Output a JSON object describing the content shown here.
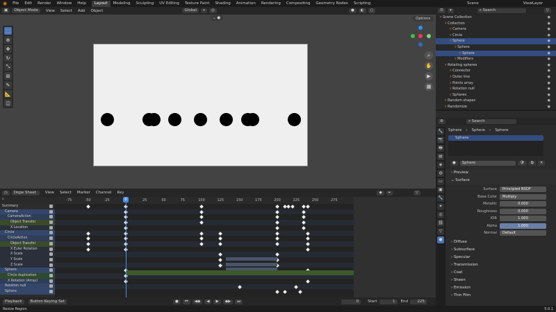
{
  "topbar": {
    "menus": [
      "File",
      "Edit",
      "Render",
      "Window",
      "Help"
    ],
    "workspaces": [
      "Layout",
      "Modeling",
      "Sculpting",
      "UV Editing",
      "Texture Paint",
      "Shading",
      "Animation",
      "Rendering",
      "Compositing",
      "Geometry Nodes",
      "Scripting"
    ],
    "active_workspace": "Layout",
    "scene": "Scene",
    "view_layer": "ViewLayer"
  },
  "viewport_header": {
    "mode": "Object Mode",
    "menus": [
      "View",
      "Select",
      "Add",
      "Object"
    ],
    "orientation": "Global",
    "options": "Options"
  },
  "dopesheet_header": {
    "mode": "Dope Sheet",
    "menus": [
      "View",
      "Select",
      "Marker",
      "Channel",
      "Key"
    ]
  },
  "ruler_ticks": [
    "-75",
    "-50",
    "-25",
    "0",
    "25",
    "50",
    "75",
    "100",
    "125",
    "150",
    "175",
    "200",
    "225",
    "250",
    "275"
  ],
  "current_frame_label": "0",
  "channels": [
    {
      "label": "Summary",
      "indent": 0,
      "bg": "#2d2d2d"
    },
    {
      "label": "Camera",
      "indent": 1,
      "bg": "#34466a"
    },
    {
      "label": "CameraAction",
      "indent": 2,
      "bg": "#2e3d58"
    },
    {
      "label": "Object Transfor",
      "indent": 3,
      "bg": "#3b4a2a"
    },
    {
      "label": "X Location",
      "indent": 3,
      "bg": "#2a2f3a"
    },
    {
      "label": "Circle",
      "indent": 1,
      "bg": "#34466a"
    },
    {
      "label": "CircleAction",
      "indent": 2,
      "bg": "#2e3d58"
    },
    {
      "label": "Object Transfor",
      "indent": 3,
      "bg": "#3b4a2a"
    },
    {
      "label": "X Euler Rotation",
      "indent": 3,
      "bg": "#2a2f3a"
    },
    {
      "label": "X Scale",
      "indent": 3,
      "bg": "#2a2f3a"
    },
    {
      "label": "Y Scale",
      "indent": 3,
      "bg": "#2a2f3a"
    },
    {
      "label": "Z Scale",
      "indent": 3,
      "bg": "#2a2f3a"
    },
    {
      "label": "Sphere",
      "indent": 1,
      "bg": "#34466a"
    },
    {
      "label": "Circle duplication",
      "indent": 2,
      "bg": "#2f4a2a"
    },
    {
      "label": "X Rotation (Array)",
      "indent": 2,
      "bg": "#2e3d58"
    },
    {
      "label": "Rotation null",
      "indent": 1,
      "bg": "#34466a"
    },
    {
      "label": "Sphere",
      "indent": 1,
      "bg": "#34466a"
    }
  ],
  "playback": {
    "playback_label": "Playback",
    "keying_label": "Button Keying Set",
    "current": "0",
    "start_label": "Start",
    "start": "1",
    "end_label": "End",
    "end": "225"
  },
  "status": {
    "left": "Resize Region",
    "right": "5.0.1"
  },
  "outliner": {
    "search_placeholder": "Search",
    "rows": [
      {
        "label": "Scene Collection",
        "indent": 0,
        "sel": false
      },
      {
        "label": "Collection",
        "indent": 1,
        "sel": false
      },
      {
        "label": "Camera",
        "indent": 2,
        "sel": false
      },
      {
        "label": "Circle",
        "indent": 2,
        "sel": false
      },
      {
        "label": "Sphere",
        "indent": 2,
        "sel": true
      },
      {
        "label": "Sphere",
        "indent": 3,
        "sel": false
      },
      {
        "label": "Sphere",
        "indent": 4,
        "sel": true
      },
      {
        "label": "Modifiers",
        "indent": 3,
        "sel": false
      },
      {
        "label": "Rotating spheres",
        "indent": 1,
        "sel": false
      },
      {
        "label": "Connector",
        "indent": 2,
        "sel": false
      },
      {
        "label": "Outer line",
        "indent": 2,
        "sel": false
      },
      {
        "label": "Points array",
        "indent": 2,
        "sel": false
      },
      {
        "label": "Rotation null",
        "indent": 2,
        "sel": false
      },
      {
        "label": "Spheres",
        "indent": 2,
        "sel": false
      },
      {
        "label": "Random shapes",
        "indent": 1,
        "sel": false
      },
      {
        "label": "Randomize",
        "indent": 1,
        "sel": false
      }
    ]
  },
  "properties": {
    "search_placeholder": "Search",
    "breadcrumb": [
      "Sphere",
      "Sphere",
      "Sphere"
    ],
    "slot": "Sphere",
    "material_name": "Sphere",
    "panels": {
      "preview": "Preview",
      "surface": "Surface"
    },
    "fields": [
      {
        "label": "Surface",
        "value": "Principled BSDF",
        "num": false
      },
      {
        "label": "Base Color",
        "value": "Multiply",
        "num": false
      },
      {
        "label": "Metallic",
        "value": "0.000",
        "num": true
      },
      {
        "label": "Roughness",
        "value": "0.000",
        "num": true
      },
      {
        "label": "IOR",
        "value": "1.000",
        "num": true
      },
      {
        "label": "Alpha",
        "value": "1.000",
        "num": true
      },
      {
        "label": "Normal",
        "value": "Default",
        "num": false
      }
    ],
    "subpanels": [
      "Diffuse",
      "Subsurface",
      "Specular",
      "Transmission",
      "Coat",
      "Sheen",
      "Emission",
      "Thin Film"
    ]
  },
  "colors": {
    "accent": "#4772b3",
    "selected": "#334d80",
    "keyframe": "#eeeeee"
  }
}
